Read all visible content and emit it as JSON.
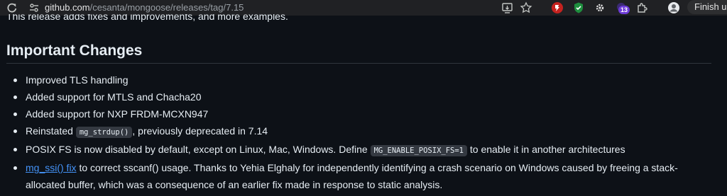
{
  "browser": {
    "url_host": "github.com",
    "url_path": "/cesanta/mongoose/releases/tag/7.15",
    "extension_badge": "13",
    "finish_label": "Finish u"
  },
  "page": {
    "clipped_line": "This release adds fixes and improvements, and more examples.",
    "section_title": "Important Changes",
    "items": [
      {
        "text": "Improved TLS handling"
      },
      {
        "text": "Added support for MTLS and Chacha20"
      },
      {
        "text": "Added support for NXP FRDM-MCXN947"
      },
      {
        "pre": "Reinstated ",
        "code": "mg_strdup()",
        "post": ", previously deprecated in 7.14"
      },
      {
        "pre": "POSIX FS is now disabled by default, except on Linux, Mac, Windows. Define ",
        "code": "MG_ENABLE_POSIX_FS=1",
        "post": " to enable it in another architectures"
      },
      {
        "link": "mg_ssi() fix",
        "post": " to correct sscanf() usage. Thanks to Yehia Elghaly for independently identifying a crash scenario on Windows caused by freeing a stack-allocated buffer, which was a consequence of an earlier fix made in response to static analysis."
      }
    ]
  },
  "colors": {
    "background": "#0d1117",
    "text": "#e6edf3",
    "link": "#4493f8",
    "code_bg": "#343941"
  }
}
